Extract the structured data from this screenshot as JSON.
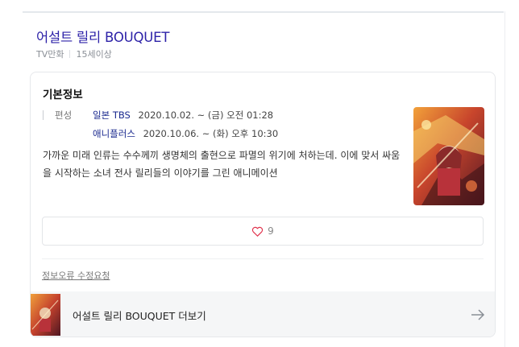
{
  "header": {
    "title": "어설트 릴리 BOUQUET",
    "category": "TV만화",
    "rating": "15세이상"
  },
  "card": {
    "section_title": "기본정보",
    "schedule_label": "편성",
    "schedule": [
      {
        "channel": "일본 TBS",
        "time": "2020.10.02. ~ (금) 오전 01:28"
      },
      {
        "channel": "애니플러스",
        "time": "2020.10.06. ~ (화) 오후 10:30"
      }
    ],
    "description": "가까운 미래 인류는 수수께끼 생명체의 출현으로 파멸의 위기에 처하는데. 이에 맞서 싸움을 시작하는 소녀 전사 릴리들의 이야기를 그린 애니메이션",
    "like_icon": "heart-icon",
    "like_count": "9",
    "report_link": "정보오류 수정요청",
    "more_label": "어설트 릴리 BOUQUET 더보기",
    "more_icon": "arrow-right-icon"
  },
  "colors": {
    "title": "#2d22a8",
    "channel": "#1b2a8f",
    "heart": "#e0314b"
  }
}
